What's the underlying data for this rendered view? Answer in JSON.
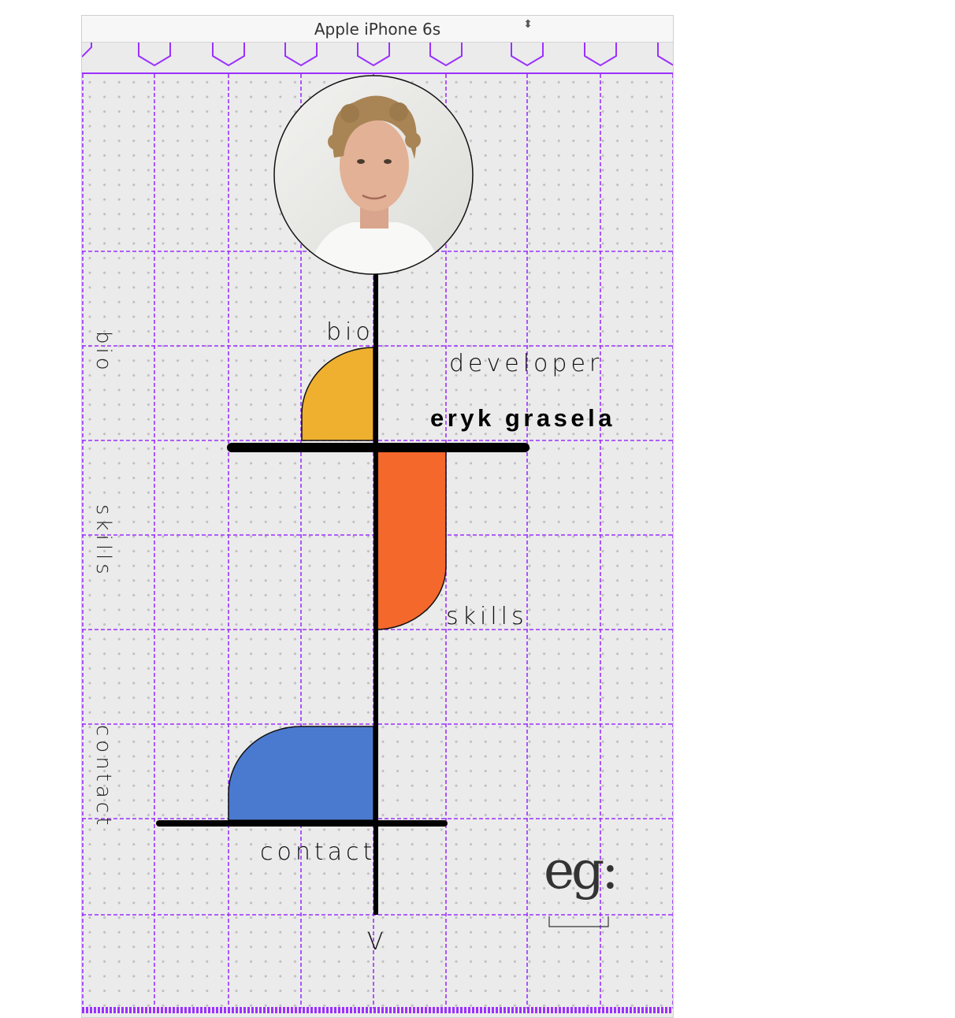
{
  "toolbar": {
    "device_label": "Apple iPhone 6s",
    "select_arrows": "⬍",
    "rotate_icon": "rotate-device-icon"
  },
  "colors": {
    "grid_line": "#9b30ff",
    "dot": "#bdbdbd",
    "background": "#ebebeb",
    "bio_shape": "#efb030",
    "skills_shape": "#f4682c",
    "contact_shape": "#4a7ad0"
  },
  "side_nav": {
    "bio": "bio",
    "skills": "skills",
    "contact": "contact"
  },
  "content": {
    "bio_label": "bio",
    "role": "developer",
    "name": "eryk grasela",
    "skills_label": "skills",
    "contact_label": "contact",
    "scroll_arrow": "V",
    "logo_text": "eg:"
  }
}
